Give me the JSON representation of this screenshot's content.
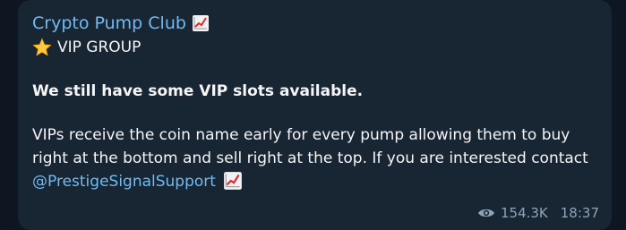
{
  "post": {
    "channel_name": "Crypto Pump Club",
    "tag_line": "VIP GROUP",
    "headline": "We still have some VIP slots available.",
    "body_main": "VIPs receive the coin name early for every pump allowing them to buy right at the bottom and sell right at the top. If you are interested contact ",
    "mention": "@PrestigeSignalSupport",
    "views": "154.3K",
    "time": "18:37"
  },
  "icons": {
    "chart": "chart-increasing-icon",
    "star": "star-icon",
    "views": "eye-icon"
  },
  "colors": {
    "background": "#0e1621",
    "bubble": "#182533",
    "link": "#71baf2",
    "meta": "#8ea4b8"
  }
}
